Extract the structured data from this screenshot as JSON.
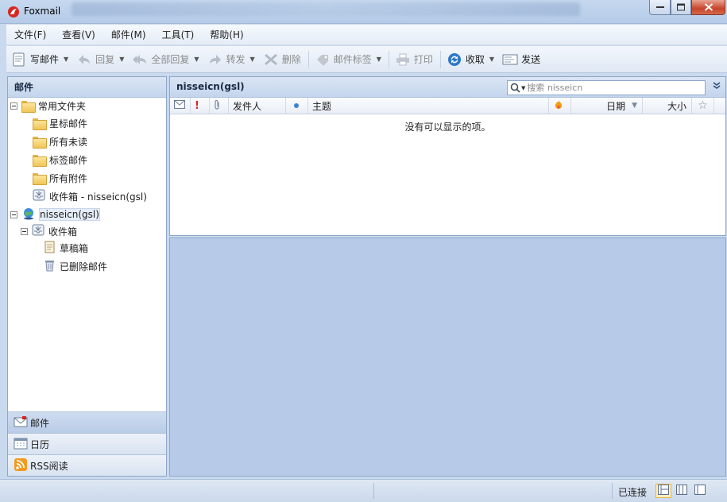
{
  "window": {
    "title": "Foxmail"
  },
  "menu": [
    {
      "label": "文件(F)"
    },
    {
      "label": "查看(V)"
    },
    {
      "label": "邮件(M)"
    },
    {
      "label": "工具(T)"
    },
    {
      "label": "帮助(H)"
    }
  ],
  "toolbar": {
    "compose": "写邮件",
    "reply": "回复",
    "reply_all": "全部回复",
    "forward": "转发",
    "delete": "删除",
    "tag": "邮件标签",
    "print": "打印",
    "receive": "收取",
    "send": "发送"
  },
  "left_pane": {
    "header": "邮件",
    "tree": {
      "common": "常用文件夹",
      "starred": "星标邮件",
      "unread": "所有未读",
      "tagged": "标签邮件",
      "attachments": "所有附件",
      "inbox_shortcut": "收件箱 - nisseicn(gsl)",
      "account": "nisseicn(gsl)",
      "inbox": "收件箱",
      "drafts": "草稿箱",
      "deleted": "已删除邮件"
    },
    "nav": {
      "mail": "邮件",
      "calendar": "日历",
      "rss": "RSS阅读"
    }
  },
  "message_list": {
    "title": "nisseicn(gsl)",
    "search_placeholder": "搜索 nisseicn",
    "columns": {
      "sender": "发件人",
      "subject": "主题",
      "date": "日期",
      "size": "大小"
    },
    "empty_text": "没有可以显示的项。"
  },
  "status": {
    "connection": "已连接"
  }
}
